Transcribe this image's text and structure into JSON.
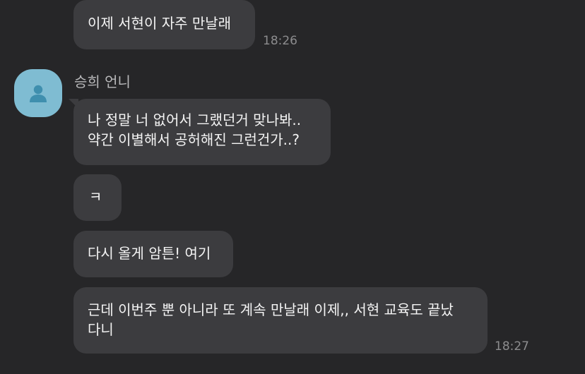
{
  "messages": [
    {
      "lines": [
        "이제 서현이 자주 만날래"
      ],
      "time": "18:26"
    },
    {
      "lines": [
        "나 정말 너 없어서 그랬던거 맞나봐..",
        "약간 이별해서 공허해진 그런건가..?"
      ]
    },
    {
      "lines": [
        "ㅋ"
      ]
    },
    {
      "lines": [
        "다시 올게 암튼! 여기"
      ]
    },
    {
      "lines": [
        "근데 이번주 뿐 아니라 또 계속 만날래 이제,, 서현 교육도 끝났",
        "다니"
      ],
      "time": "18:27"
    }
  ],
  "sender": {
    "name": "승희 언니",
    "avatar_icon": "default-profile-person-icon",
    "avatar_color": "#7fbcd2"
  },
  "colors": {
    "background": "#262628",
    "bubble": "#3c3c3f",
    "text": "#f4f4f4",
    "time": "#8c8c8e"
  }
}
